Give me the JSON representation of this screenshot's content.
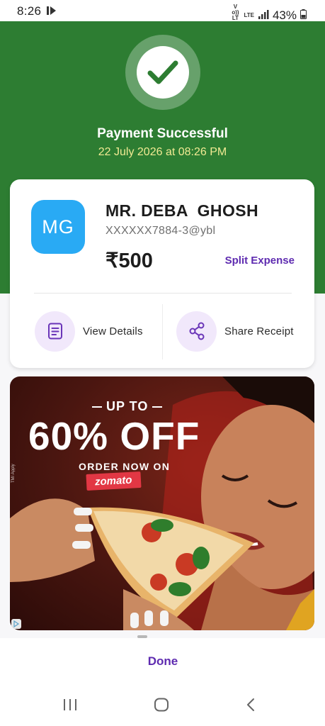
{
  "status_bar": {
    "time": "8:26",
    "net_top": "Vo)) LTE",
    "net_mid": "LTE",
    "battery": "43%"
  },
  "header": {
    "title": "Payment Successful",
    "datetime": "22 July 2026 at 08:26 PM",
    "icon": "check-icon"
  },
  "payee": {
    "initials": "MG",
    "name": "MR. DEBA  GHOSH",
    "upi_id": "XXXXXX7884-3@ybl",
    "amount": "₹500",
    "split_label": "Split Expense"
  },
  "actions": {
    "view_details": "View Details",
    "share_receipt": "Share Receipt"
  },
  "ad": {
    "upto": "UP TO",
    "headline": "60% OFF",
    "order_text": "ORDER NOW ON",
    "brand": "zomato",
    "tm": "TM/ Apply"
  },
  "footer": {
    "done_label": "Done"
  },
  "colors": {
    "green": "#2d7d32",
    "purple": "#5e2bb0",
    "avatar_blue": "#29aaf4",
    "date_yellow": "#f1ea93"
  }
}
